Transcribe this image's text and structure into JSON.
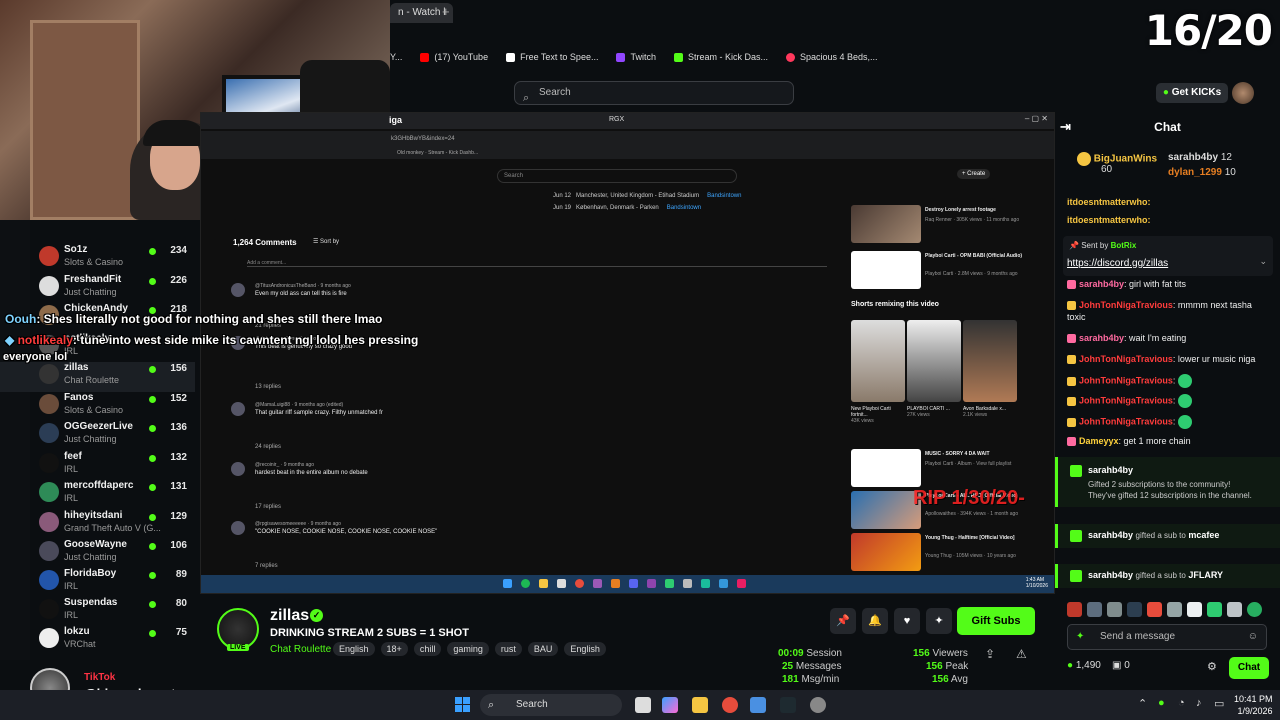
{
  "browser": {
    "tab_label": "n - Watch l",
    "bookmarks": [
      "Y...",
      "(17) YouTube",
      "Free Text to Spee...",
      "Twitch",
      "Stream - Kick Das...",
      "Spacious 4 Beds,..."
    ],
    "search_placeholder": "Search"
  },
  "counter": "16/20",
  "header": {
    "get_kicks": "Get KICKs"
  },
  "sidebar": {
    "items": [
      {
        "name": "So1z",
        "category": "Slots & Casino",
        "viewers": "234",
        "color": "#c0392b"
      },
      {
        "name": "FreshandFit",
        "category": "Just Chatting",
        "viewers": "226",
        "color": "#dddddd"
      },
      {
        "name": "ChickenAndy",
        "category": "",
        "viewers": "218",
        "color": "#8e6b4a"
      },
      {
        "name": "notlikealy",
        "category": "IRL",
        "viewers": "",
        "color": "#555555"
      },
      {
        "name": "zillas",
        "category": "Chat Roulette",
        "viewers": "156",
        "color": "#333333"
      },
      {
        "name": "Fanos",
        "category": "Slots & Casino",
        "viewers": "152",
        "color": "#6a4c3a"
      },
      {
        "name": "OGGeezerLive",
        "category": "Just Chatting",
        "viewers": "136",
        "color": "#2b3d55"
      },
      {
        "name": "feef",
        "category": "IRL",
        "viewers": "132",
        "color": "#111111"
      },
      {
        "name": "mercoffdaperc",
        "category": "IRL",
        "viewers": "131",
        "color": "#2e8b57"
      },
      {
        "name": "hiheyitsdani",
        "category": "Grand Theft Auto V (G...",
        "viewers": "129",
        "color": "#8a5a7a"
      },
      {
        "name": "GooseWayne",
        "category": "Just Chatting",
        "viewers": "106",
        "color": "#4a4a5a"
      },
      {
        "name": "FloridaBoy",
        "category": "IRL",
        "viewers": "89",
        "color": "#2255aa"
      },
      {
        "name": "Suspendas",
        "category": "IRL",
        "viewers": "80",
        "color": "#111111"
      },
      {
        "name": "lokzu",
        "category": "VRChat",
        "viewers": "75",
        "color": "#eeeeee"
      }
    ]
  },
  "overlay": {
    "msg1_user": "Oouh",
    "msg1_text": ": Shes literally not good for nothing and shes still there lmao",
    "msg2_user": "notlikealy",
    "msg2_text": ": tune into west side mike its cawntent ngl lolol hes pressing",
    "msg2_cont": "everyone lol",
    "tiktok_label": "TikTok",
    "tiktok_handle": "@bigsackwontsags",
    "watermark": "RIP 1/30/20-"
  },
  "youtube": {
    "window_title": "iga",
    "address": "k3GHbBwYB&index=24",
    "rgx": "RGX",
    "search": "Search",
    "create": "+ Create",
    "comments_count": "1,264 Comments",
    "sort_by": "Sort by",
    "add_comment": "Add a comment...",
    "tour": [
      {
        "date": "Jun 12",
        "place": "Manchester, United Kingdom - Etihad Stadium",
        "link": "Bandsintown"
      },
      {
        "date": "Jun 19",
        "place": "København, Denmark - Parken",
        "link": "Bandsintown"
      }
    ],
    "comments": [
      {
        "user": "@TitusAndronicusTheBand · 9 months ago",
        "text": "Even my old ass can tell this is fire",
        "replies": "21 replies"
      },
      {
        "user": "@dolcamgs · 9 months ago",
        "text": "This beat is genuinely so crazy good",
        "replies": "13 replies"
      },
      {
        "user": "@MamaLuigi88 · 9 months ago (edited)",
        "text": "That guitar riff sample crazy. Filthy unmatched fr",
        "replies": "24 replies"
      },
      {
        "user": "@recoinir_ · 9 months ago",
        "text": "hardest beat in the entire album no debate",
        "replies": "17 replies"
      },
      {
        "user": "@rpgisawesomeeeeee · 9 months ago",
        "text": "\"COOKIE NOSE, COOKIE NOSE, COOKIE NOSE, COOKIE NOSE\"",
        "replies": "7 replies"
      }
    ],
    "side_videos": [
      {
        "title": "Destroy Lonely arrest footage",
        "meta": "Raq Renner · 305K views · 11 months ago"
      },
      {
        "title": "Playboi Carti - OPM BABI (Official Audio)",
        "meta": "Playboi Carti · 2.8M views · 9 months ago"
      }
    ],
    "shorts_header": "Shorts remixing this video",
    "shorts": [
      {
        "title": "New Playboi Carti fortnit...",
        "views": "43K views"
      },
      {
        "title": "PLAYBOI CARTI ...",
        "views": "27K views"
      },
      {
        "title": "Avon Barksdale x...",
        "views": "2.1K views"
      }
    ],
    "side_videos2": [
      {
        "title": "MUSIC - SORRY 4 DA WAIT",
        "meta": "Playboi Carti · Album · View full playlist"
      },
      {
        "title": "Playboi Carti - ALL RED (Official Video)",
        "meta": "Apollowaithes · 394K views · 1 month ago"
      },
      {
        "title": "Young Thug - Halftime [Official Video]",
        "meta": "Young Thug · 105M views · 10 years ago"
      }
    ],
    "clock": "1:43 AM\n1/10/2026"
  },
  "stream": {
    "channel": "zillas",
    "title": "DRINKING STREAM 2 SUBS = 1 SHOT",
    "category": "Chat Roulette",
    "tags": [
      "English",
      "18+",
      "chill",
      "gaming",
      "rust",
      "BAU",
      "English"
    ],
    "gift_subs": "Gift Subs",
    "session_time": "00:09",
    "session_label": "Session",
    "messages": "25",
    "messages_label": "Messages",
    "msg_per_min": "181",
    "msg_per_min_label": "Msg/min",
    "viewers": "156",
    "viewers_label": "Viewers",
    "peak": "156",
    "peak_label": "Peak",
    "avg": "156",
    "avg_label": "Avg",
    "live_label": "LIVE"
  },
  "chat": {
    "header": "Chat",
    "leaders": [
      {
        "name": "BigJuanWins",
        "count": "60"
      },
      {
        "name": "sarahb4by",
        "count": "12"
      },
      {
        "name": "dylan_1299",
        "count": "10"
      }
    ],
    "pinned_sender_label": "Sent by",
    "pinned_sender": "BotRix",
    "pinned_link": "https://discord.gg/zillas",
    "top_msgs": [
      "itdoesntmatterwho:",
      "itdoesntmatterwho:"
    ],
    "messages": [
      {
        "user": "sarahb4by",
        "text": ": girl with fat tits",
        "color": "#ff6aa0"
      },
      {
        "user": "JohnTonNigaTravious",
        "text": ": mmmm next tasha toxic",
        "color": "#ff3c3c"
      },
      {
        "user": "sarahb4by",
        "text": ": wait I'm eating",
        "color": "#ff6aa0"
      },
      {
        "user": "JohnTonNigaTravious",
        "text": ": lower ur music niga",
        "color": "#ff3c3c"
      },
      {
        "user": "JohnTonNigaTravious",
        "text": ":",
        "color": "#ff3c3c"
      },
      {
        "user": "JohnTonNigaTravious",
        "text": ":",
        "color": "#ff3c3c"
      },
      {
        "user": "JohnTonNigaTravious",
        "text": ":",
        "color": "#ff3c3c"
      },
      {
        "user": "Dameyyx",
        "text": ": get 1 more chain",
        "color": "#ffd23c"
      }
    ],
    "gift1_user": "sarahb4by",
    "gift1_line1": "Gifted 2 subscriptions to the community!",
    "gift1_line2": "They've gifted 12 subscriptions in the channel.",
    "gift2_user": "sarahb4by",
    "gift2_mid": "gifted a sub to",
    "gift2_target": "mcafee",
    "gift3_user": "sarahb4by",
    "gift3_mid": "gifted a sub to",
    "gift3_target": "JFLARY",
    "input_placeholder": "Send a message",
    "kicks": "1,490",
    "subs_count": "0",
    "send_label": "Chat"
  },
  "taskbar": {
    "search": "Search",
    "time": "10:41 PM",
    "date": "1/9/2026"
  }
}
